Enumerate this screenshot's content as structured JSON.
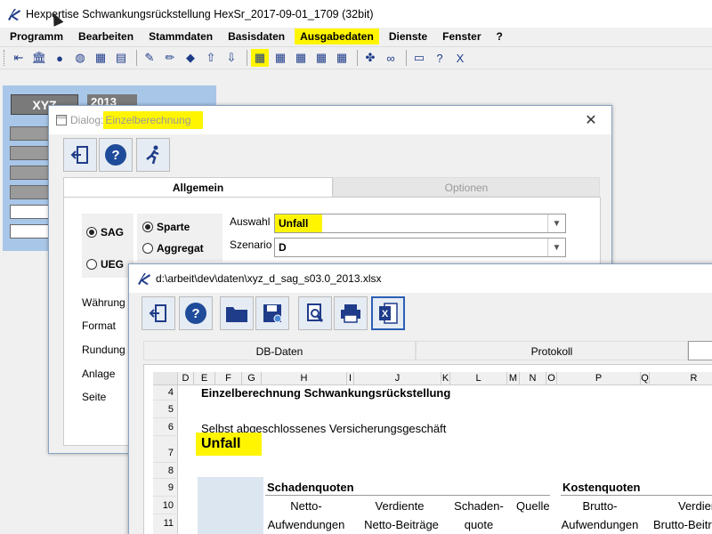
{
  "window": {
    "title": "Hexpertise Schwankungsrückstellung HexSr_2017-09-01_1709 (32bit)"
  },
  "menu": [
    "Programm",
    "Bearbeiten",
    "Stammdaten",
    "Basisdaten",
    "Ausgabedaten",
    "Dienste",
    "Fenster",
    "?"
  ],
  "menu_highlight": "Ausgabedaten",
  "toolbar": [
    {
      "icon": "exit-icon"
    },
    {
      "icon": "bank-icon"
    },
    {
      "icon": "users-icon"
    },
    {
      "icon": "globe-icon"
    },
    {
      "icon": "calculator-icon"
    },
    {
      "icon": "printer-icon"
    },
    {
      "sep": true
    },
    {
      "icon": "edit-form-icon"
    },
    {
      "icon": "pencil-icon"
    },
    {
      "icon": "eraser-icon"
    },
    {
      "icon": "upload-icon"
    },
    {
      "icon": "download-icon"
    },
    {
      "sep": true
    },
    {
      "icon": "grid-yellow-icon",
      "highlight": true
    },
    {
      "icon": "grid-icon"
    },
    {
      "icon": "grid-icon"
    },
    {
      "icon": "grid-icon"
    },
    {
      "icon": "grid-icon"
    },
    {
      "sep": true
    },
    {
      "icon": "puzzle-icon"
    },
    {
      "icon": "binoculars-icon"
    },
    {
      "sep": true
    },
    {
      "icon": "window-icon"
    },
    {
      "icon": "help-icon"
    },
    {
      "icon": "excel-icon"
    }
  ],
  "bgpanel": {
    "xyz": "XYZ",
    "year": "2013"
  },
  "dialog": {
    "title_prefix": "Dialog: ",
    "title_highlight": "Einzelberechnung",
    "tabs": [
      "Allgemein",
      "Optionen"
    ],
    "radio_left": [
      "SAG",
      "UEG"
    ],
    "radio_right": [
      "Sparte",
      "Aggregat"
    ],
    "side_labels": [
      "Währung",
      "Format",
      "Rundung",
      "Anlage",
      "Seite"
    ],
    "auswahl_label": "Auswahl",
    "auswahl_value": "Unfall",
    "szenario_label": "Szenario",
    "szenario_value": "D"
  },
  "excel": {
    "title": "d:\\arbeit\\dev\\daten\\xyz_d_sag_s03.0_2013.xlsx",
    "tabs": [
      "DB-Daten",
      "Protokoll"
    ],
    "columns": [
      "D",
      "E",
      "F",
      "G",
      "H",
      "I",
      "J",
      "K",
      "L",
      "M",
      "N",
      "O",
      "P",
      "Q",
      "R"
    ],
    "rows": [
      "4",
      "5",
      "6",
      "7",
      "8",
      "9",
      "10",
      "11"
    ],
    "heading": "Einzelberechnung Schwankungsrückstellung",
    "subheading": "Selbst abgeschlossenes Versicherungsgeschäft",
    "sparte": "Unfall",
    "section1": "Schadenquoten",
    "section2": "Kostenquoten",
    "col_netto_aufw_1": "Netto-",
    "col_netto_aufw_2": "Aufwendungen",
    "col_verd_netto_1": "Verdiente",
    "col_verd_netto_2": "Netto-Beiträge",
    "col_schaden_1": "Schaden-",
    "col_schaden_2": "quote",
    "col_quelle": "Quelle",
    "col_brutto_aufw_1": "Brutto-",
    "col_brutto_aufw_2": "Aufwendungen",
    "col_verd_brutto_1": "Verdient",
    "col_verd_brutto_2": "Brutto-Beitr"
  },
  "colors": {
    "highlight": "#fff500",
    "accent": "#1f3c8a",
    "panel": "#a8c6e8"
  }
}
